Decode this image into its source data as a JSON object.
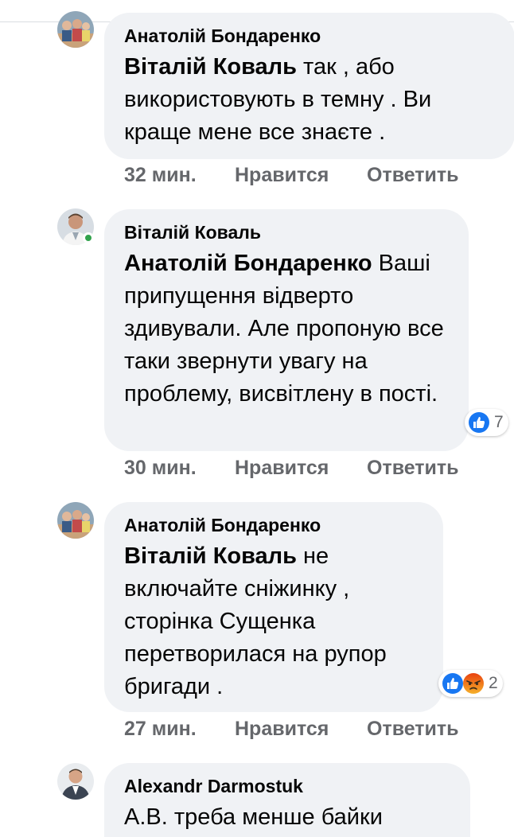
{
  "comments": [
    {
      "author": "Анатолій Бондаренко",
      "mention": "Віталій Коваль",
      "text": " так , або використовують в темну . Ви краще мене все знаєте .",
      "time": "32 мин.",
      "like_label": "Нравится",
      "reply_label": "Ответить",
      "avatar_icon": "group-photo-avatar"
    },
    {
      "author": "Віталій Коваль",
      "mention": "Анатолій Бондаренко",
      "text": " Ваші припущення відверто здивували. Але пропоную все таки звернути увагу на проблему, висвітлену в пості.",
      "time": "30 мин.",
      "like_label": "Нравится",
      "reply_label": "Ответить",
      "avatar_icon": "man-portrait-avatar",
      "online": true,
      "reactions": {
        "icons": [
          "like-icon"
        ],
        "count": "7"
      }
    },
    {
      "author": "Анатолій Бондаренко",
      "mention": "Віталій Коваль",
      "text": " не включайте сніжинку , сторінка Сущенка перетворилася на рупор бригади .",
      "time": "27 мин.",
      "like_label": "Нравится",
      "reply_label": "Ответить",
      "avatar_icon": "group-photo-avatar",
      "reactions": {
        "icons": [
          "like-icon",
          "angry-icon"
        ],
        "count": "2"
      }
    },
    {
      "author": "Alexandr Darmostuk",
      "text": "А.В. треба менше байки",
      "avatar_icon": "man-suit-avatar"
    }
  ],
  "colors": {
    "bubble": "#f0f2f5",
    "like": "#1877f2",
    "angry": "#e9710f",
    "online": "#31a24c",
    "meta": "#65676b"
  }
}
